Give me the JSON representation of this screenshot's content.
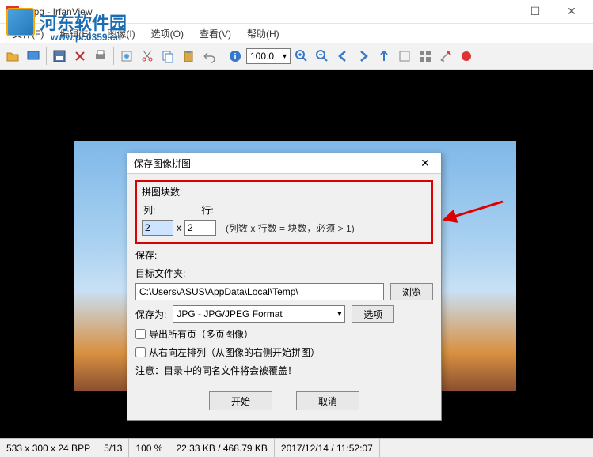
{
  "window": {
    "title": "3.jpg - IrfanView",
    "min": "—",
    "max": "☐",
    "close": "✕"
  },
  "menu": {
    "file": "文件(F)",
    "edit": "编辑(E)",
    "image": "图像(I)",
    "options": "选项(O)",
    "view": "查看(V)",
    "help": "帮助(H)"
  },
  "toolbar": {
    "zoom_value": "100.0"
  },
  "dialog": {
    "title": "保存图像拼图",
    "tiles_group": "拼图块数:",
    "col_label": "列:",
    "row_label": "行:",
    "col_val": "2",
    "row_val": "2",
    "x_sep": "x",
    "hint": "(列数 x 行数 = 块数，必须 > 1)",
    "save_group": "保存:",
    "target_folder_label": "目标文件夹:",
    "path": "C:\\Users\\ASUS\\AppData\\Local\\Temp\\",
    "browse": "浏览",
    "save_as_label": "保存为:",
    "format": "JPG - JPG/JPEG Format",
    "options": "选项",
    "export_all": "导出所有页（多页图像）",
    "rtl": "从右向左排列（从图像的右侧开始拼图）",
    "warning": "注意：目录中的同名文件将会被覆盖！",
    "start": "开始",
    "cancel": "取消"
  },
  "status": {
    "dims": "533 x 300 x 24 BPP",
    "page": "5/13",
    "zoom": "100 %",
    "size": "22.33 KB / 468.79 KB",
    "date": "2017/12/14 / 11:52:07"
  },
  "watermark": {
    "text": "河东软件园",
    "url": "www.pc0359.cn"
  },
  "colors": {
    "highlight": "#d00",
    "accent": "#1a6db5"
  }
}
